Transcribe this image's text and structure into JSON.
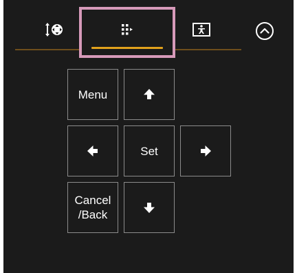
{
  "tabs": [
    {
      "id": "pan-tilt",
      "icon": "pan-tilt-icon",
      "active": false
    },
    {
      "id": "menu-control",
      "icon": "menu-grid-icon",
      "active": true
    },
    {
      "id": "assignable",
      "icon": "assignable-icon",
      "active": false
    }
  ],
  "collapse": {
    "icon": "chevron-up-circle-icon"
  },
  "dpad": {
    "menu_label": "Menu",
    "set_label": "Set",
    "cancel_label": "Cancel\n/Back",
    "up_icon": "arrow-up-icon",
    "down_icon": "arrow-down-icon",
    "left_icon": "arrow-left-icon",
    "right_icon": "arrow-right-icon"
  },
  "colors": {
    "background": "#1b1b1b",
    "button_border": "#8c8c8c",
    "active_underline": "#e2a21c",
    "divider": "#6f4e1c",
    "highlight_frame": "#d79aba",
    "text": "#ffffff"
  }
}
